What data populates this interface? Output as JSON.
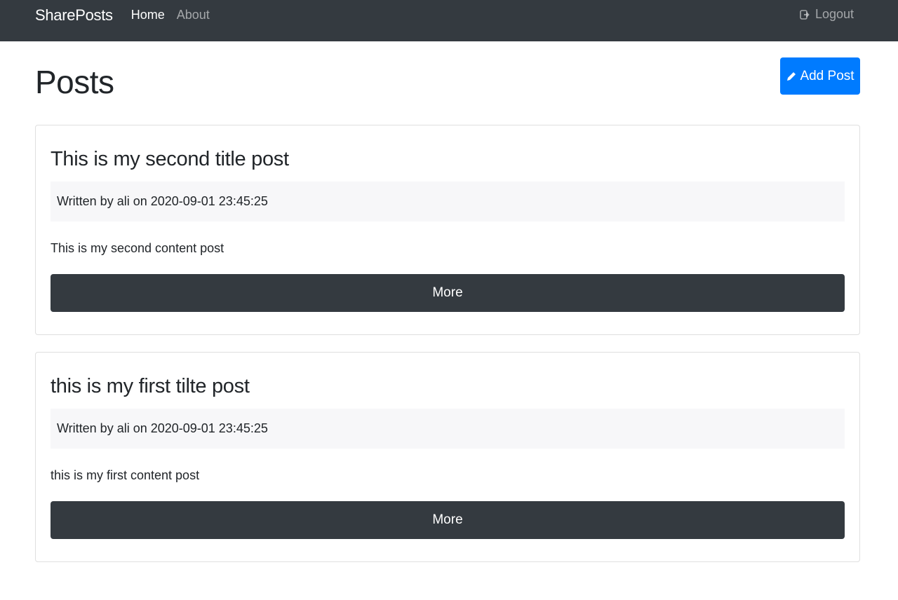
{
  "navbar": {
    "brand": "SharePosts",
    "links": [
      {
        "label": "Home",
        "active": true
      },
      {
        "label": "About",
        "active": false
      }
    ],
    "logout_label": "Logout"
  },
  "page": {
    "title": "Posts",
    "add_button_label": "Add Post"
  },
  "posts": [
    {
      "title": "This is my second title post",
      "meta": "Written by ali on 2020-09-01 23:45:25",
      "content": "This is my second content post",
      "button_label": "More"
    },
    {
      "title": "this is my first tilte post",
      "meta": "Written by ali on 2020-09-01 23:45:25",
      "content": "this is my first content post",
      "button_label": "More"
    }
  ],
  "colors": {
    "navbar_bg": "#343a40",
    "primary": "#007bff",
    "dark_button": "#343a40",
    "meta_bg": "#f7f7f9"
  }
}
